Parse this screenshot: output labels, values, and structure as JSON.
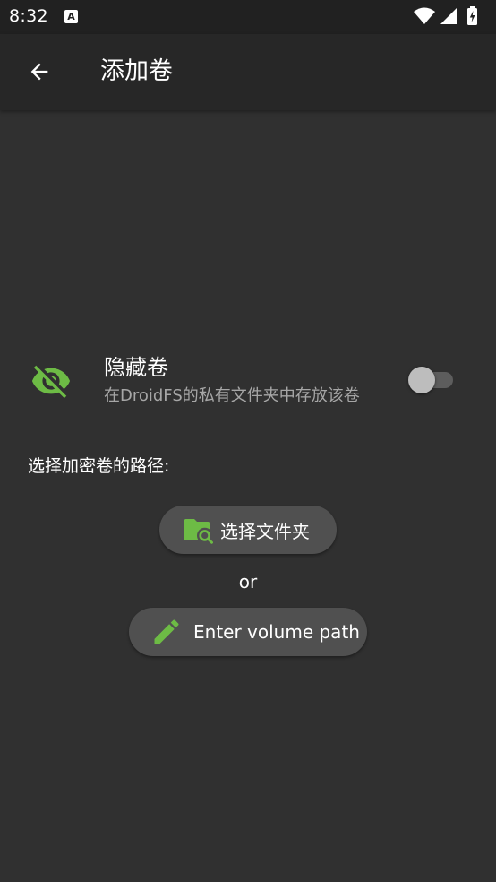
{
  "status_bar": {
    "time": "8:32",
    "notification_icon": "A"
  },
  "app_bar": {
    "back_icon": "arrow-left-icon",
    "title": "添加卷"
  },
  "hidden_volume": {
    "icon": "eye-off-icon",
    "title": "隐藏卷",
    "subtitle": "在DroidFS的私有文件夹中存放该卷",
    "enabled": false
  },
  "path_label": "选择加密卷的路径:",
  "select_folder_button": {
    "icon": "folder-search-icon",
    "label": "选择文件夹"
  },
  "or_text": "or",
  "enter_path_button": {
    "icon": "pencil-icon",
    "label": "Enter volume path"
  },
  "colors": {
    "background": "#303030",
    "app_bar": "#272727",
    "status_bar": "#212121",
    "accent_green": "#6dbb45",
    "button_bg": "#505050",
    "subtitle_text": "#a6a6a6"
  }
}
